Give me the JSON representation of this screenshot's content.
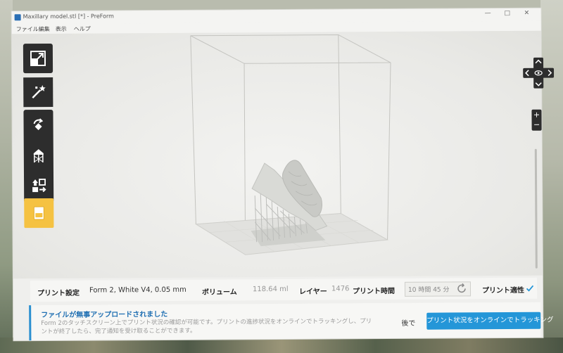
{
  "window": {
    "title": "Maxillary model.stl [*] - PreForm",
    "controls": [
      "—",
      "□",
      "✕"
    ]
  },
  "menu": [
    "ファイル",
    "編集",
    "表示",
    "ヘルプ"
  ],
  "toolbar": {
    "tools": [
      {
        "name": "scale-tool",
        "icon": "expand-arrow-icon"
      },
      {
        "name": "one-click-print-tool",
        "icon": "magic-wand-icon"
      },
      {
        "name": "orientation-tool",
        "icon": "rotate-icon"
      },
      {
        "name": "supports-tool",
        "icon": "support-structure-icon"
      },
      {
        "name": "layout-tool",
        "icon": "layout-arrange-icon"
      }
    ],
    "active_tool": {
      "name": "print-tool",
      "icon": "printer-icon",
      "color": "#f5c242"
    }
  },
  "view_controls": {
    "zoom_in": "+",
    "zoom_out": "−",
    "center_icon": "eye-icon"
  },
  "status": {
    "print_settings_label": "プリント設定",
    "print_settings_value": "Form 2, White V4, 0.05 mm",
    "volume_label": "ボリューム",
    "volume_value": "118.64 ml",
    "layers_label": "レイヤー",
    "layers_value": "1476",
    "print_time_label": "プリント時間",
    "print_time_value": "10 時間 45 分",
    "printability_label": "プリント適性",
    "printability_icon": "checkmark-icon"
  },
  "notification": {
    "title": "ファイルが無事アップロードされました",
    "body": "Form 2のタッチスクリーン上でプリント状況の確認が可能です。プリントの進捗状況をオンラインでトラッキングし、プリントが終了したら、完了通知を受け取ることができます。",
    "later_label": "後で",
    "track_label": "プリント状況をオンラインでトラッキング"
  },
  "colors": {
    "accent": "#2496d8",
    "active_tool": "#f5c242",
    "toolbar": "#2d2d2d",
    "check": "#2496d8"
  }
}
